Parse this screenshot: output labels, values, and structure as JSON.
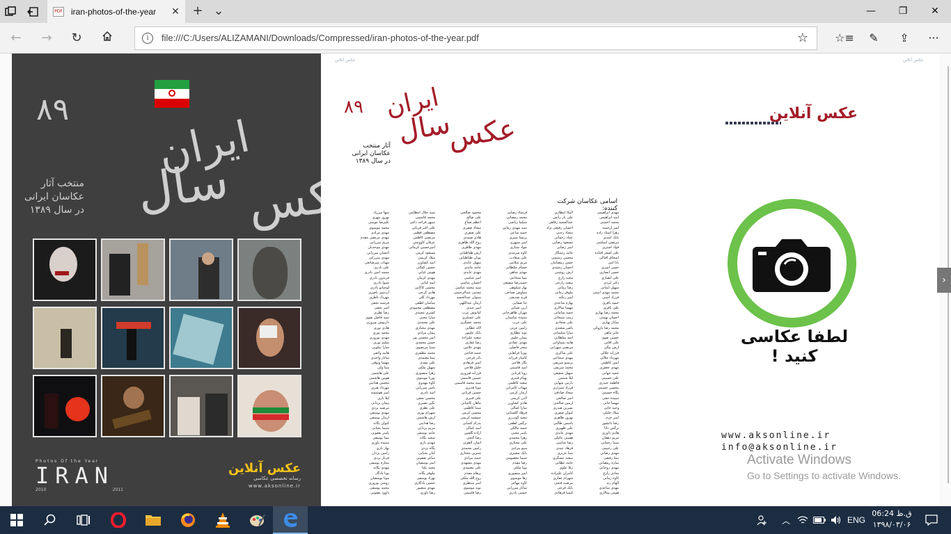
{
  "browser": {
    "tab_title": "iran-photos-of-the-year",
    "tab_favicon": "PDF",
    "url": "file:///C:/Users/ALIZAMANI/Downloads/Compressed/iran-photos-of-the-year.pdf"
  },
  "cover": {
    "title_word_1": "عکس",
    "title_word_2": "سال",
    "title_word_3": "ایران",
    "title_year": "۸۹",
    "subtitle_lines": [
      "منتخب آثار",
      "عکاسان ایرانی",
      "در سال ۱۳۸۹"
    ],
    "footer_label": "Photos Of the Year",
    "footer_word": "IRAN",
    "footer_year_left": "2010",
    "footer_year_right": "2011",
    "brand_name": "عکس آنلاین",
    "brand_tagline": "رسانه تخصصی عکاسی",
    "brand_url": "www.aksonline.ir"
  },
  "inner": {
    "header_left": "عکس آنلاین",
    "header_right": "عکس آنلاین",
    "title_word_1": "عکس",
    "title_word_2": "سال",
    "title_word_3": "ایران",
    "title_year": "۸۹",
    "intro_lines": [
      "آثار منتخب",
      "عکاسان ایرانی",
      "در سال ۱۳۸۹"
    ],
    "list_heading": "اسامی عکاسان شرکت کننده:",
    "photographers": [
      [
        "مهدی ابراهیمی",
        "امید ابراهیمی",
        "محمد احمدی",
        "امیر ارجمند",
        "زهرا استاد زاده",
        "بابک اسدی",
        "مرتضی اسکینی",
        "فواد اشتری",
        "علی اصغر افتاده",
        "اسحاق اقبالی",
        "بابا امن",
        "حسن امیری",
        "حسن انصاری",
        "علی انصاری",
        "دکتر ایزدی",
        "سهیل ایمانی",
        "محمد مهدی امینی",
        "فرزاد امینی",
        "حمید باقری",
        "علی باقری",
        "محمد رضا بهاری",
        "احسان بهمنی",
        "ساناز بهاری",
        "محمد رضا پازوکی",
        "جابر پناهی",
        "حسین تقوی",
        "علی آقایی",
        "آرش بیگی",
        "فرزانه جلالی",
        "مهرداد جلالی",
        "امین کاظمی",
        "مهدی جعفری",
        "حمید جهانی",
        "علی حسینی",
        "فاطمه حیدری",
        "محسن حسینی",
        "پگاه حسینی",
        "سپیده حقی",
        "مهسا خانی",
        "وحید خانی",
        "میلاد خلیلی",
        "امیر خرم",
        "رضا دانشور",
        "نرگس دانا",
        "هادی داوری",
        "مریم دهقان",
        "سینا رحمانی",
        "علی رحیمی",
        "مهدی رضایی",
        "نیما رفیعی",
        "ساره رمضانی",
        "مهدی روحانی",
        "شادی زارع",
        "کاوه زمانی",
        "الهام زند",
        "مهدی ساعدی",
        "هومن سالاری"
      ],
      [
        "الیکا انتظاری",
        "علی بار رانش",
        "عبدالمجید رفاهی",
        "احسان رفیعی نژاد",
        "سجاد رجبی",
        "عماد رحمانی",
        "مسعود رضایی",
        "امیر رضایی",
        "حامد رستگار",
        "محسن رستمی",
        "حسن رمضانیان",
        "احسان رشیدی",
        "آرش روشنی",
        "مجید زارع",
        "سعید زارعی",
        "رضا زمانی",
        "نیلوفر زمانی",
        "امیر زنگنه",
        "بهاره ساعدی",
        "مهسا سالاری",
        "حمید سامانی",
        "زینب سبحانی",
        "علی سجادی",
        "ناصر سعیدی",
        "سارا سلیمانی",
        "امید سلطانی",
        "هانیه سماواتی",
        "مرتضی سهرابی",
        "علی شاکری",
        "مهدی شجاعی",
        "پرستو شریفی",
        "محمد شریفی",
        "سهیل شفیعی",
        "لیلا شمس",
        "نازنین شهابی",
        "فرزاد شیرازی",
        "سجاد صادقی",
        "امیر صالحی",
        "آرمین صالحی",
        "نسرین صدری",
        "کیوان صفری",
        "بهروز طاهری",
        "یاسمن طالبی",
        "علی ظهیری",
        "مهدی عابدی",
        "هستی عاملی",
        "رضا عباسی",
        "فرهاد عبدی",
        "مینا عزیزی",
        "سعید عسگری",
        "حامد عطایی",
        "ژیلا علوی",
        "کامران علیزاده",
        "شهرام غفاری",
        "مرضیه فتحی",
        "بابک فرجی",
        "کیمیا فرهادی"
      ],
      [
        "فرشاد رضایی",
        "محمد رمضانی",
        "شکیبا ریاضی",
        "سید مهدی زمانی",
        "حمید ساعی",
        "پریسا سبزی",
        "امیر سپهری",
        "جواد ستاری",
        "کاوه سرمدی",
        "علی سعادت",
        "مریم سلامی",
        "حسام سلطانی",
        "مهدی شاهی",
        "نیما شجاعی",
        "حمیدرضا شفیعی",
        "بهار شکوهی",
        "سیاوش صباحی",
        "فرید صدیقی",
        "ندا صفایی",
        "آرین ضیایی",
        "مهران طاهرخانی",
        "سپیده عباسیان",
        "علی عرب",
        "رامین عزتی",
        "نوید عطاری",
        "پیمان علوی",
        "مهدی عمادی",
        "سحر فاضلی",
        "پوریا فراهانی",
        "کامیار فرزانه",
        "نگار فلاحی",
        "امید قاسمی",
        "رویا قربانی",
        "بهنام قنبری",
        "سعید کاظمی",
        "مهتاب کامرانی",
        "آرمان کرمی",
        "لادن کریمی",
        "هادی کشاورز",
        "سارا کمالی",
        "فرهاد گلستانی",
        "مجید گودرزی",
        "نرگس لطفی",
        "حمید مالکی",
        "یاسر محبی",
        "زهرا محمدی",
        "علی مختاری",
        "مینو مرادی",
        "بابک مشیری",
        "شیما معصومی",
        "رضا مقدم",
        "پویا ملکی",
        "امیر منصوری",
        "رها موسوی",
        "کاوه مهاجر",
        "ساناز میرزایی",
        "حسین نادری"
      ],
      [
        "محمود صالحی",
        "علی صالح",
        "اعظم صباغ",
        "سجاد صفری",
        "علی صفری",
        "هادی صمدی",
        "روح الله طاهری",
        "مهدی طاهری",
        "آرش طباطبایی",
        "پویان طباطبایی",
        "سهیل عابدی",
        "حامد عابدی",
        "مهدی عابدی",
        "امیر عباسی",
        "احسان عباسی",
        "سید محمد عباسی",
        "مجتبی عبدالرحیمی",
        "سیوان عبدالحمید",
        "آرمان عبداللهی",
        "امیر عبدی",
        "کیانوش عرب",
        "علی عسکری",
        "محمد عسگری",
        "لاله عطایی",
        "بابک علیپور",
        "سعید علیزاده",
        "رضا غفاری",
        "مهدی غلامی",
        "حمید فتاحی",
        "نادر فرجی",
        "امین فرهادی",
        "خلیل فلاحی",
        "فرزانه فیروزی",
        "حسین قاسمی",
        "سید محمد قاسمی",
        "مونا قدیری",
        "حسین قربانی",
        "علی قنبری",
        "ماهان کاشانی",
        "سینا کاظمی",
        "محسن کرمی",
        "جمشید کریمی",
        "پدرام کسایی",
        "امید کمالی",
        "آزاده گلچین",
        "رضا گنجی",
        "ایمان لاهوتی",
        "رامین محمدی",
        "شیرین مختاری",
        "حمید مرادی",
        "مهدی مشهدی",
        "علی معتمدی",
        "پرهام مقدم",
        "روح الله ملکی",
        "امیر منتظری",
        "نوید موسوی",
        "رضا قاسمی"
      ],
      [
        "سید جلال انتظامی",
        "محمد قاسمی",
        "سپهر قراجه داغی",
        "علی اکبر قربانی",
        "مصطفی قطبی",
        "مرتضی کاظمی",
        "عرفان کاووسی",
        "امیرحسین کرمانی",
        "مسعود کرمی",
        "میلاد کریمی",
        "امید کشاورز",
        "حسین کمالی",
        "هومن کیانی",
        "مهدی کرمان",
        "امید کیانی",
        "محسن کاکایی",
        "هادی گرجی",
        "مهرداد گلی",
        "ساسان لطفی",
        "مصطفی محمودی",
        "کسری مجیدی",
        "سارا محبی",
        "علی محمدی",
        "مهدی مختاری",
        "پیمان مرادی",
        "امیر محسن پور",
        "حسن محمدی",
        "سینا مرتضوی",
        "محمد مظفری",
        "نیما معتمدی",
        "علی مقدم",
        "سهیل ملکی",
        "زهرا منصوری",
        "پوریا موسوی",
        "کاوه مهدوی",
        "یاسر میرزایی",
        "امید نادری",
        "محسن نجفی",
        "نگین نصیری",
        "علی نظری",
        "شهرام نوری",
        "آرش هاشمی",
        "رضا هدایتی",
        "مریم یزدانی",
        "حامد یوسفی",
        "سعید یگانه",
        "مهدی یاری",
        "پگاه یزدی",
        "کیان یحیایی",
        "ساغر یعقوبی",
        "امیر یوسفیان",
        "مجید یکتا",
        "نیلوفر یگانه",
        "بهزاد یوسفی",
        "حسین یادگاری",
        "مهدی منصور",
        "رضا یاوری"
      ],
      [
        "سها میرزاد",
        "بهروز مهری",
        "علیرضا مومنی",
        "محمد موسوی",
        "مهدی مرادی",
        "مهدی مرتضی مقدم",
        "مریم میرزایی",
        "مهدی موحدیان",
        "احسان میرزایی",
        "مهدی میرزایی",
        "مهتاب میرصانعی",
        "علی نادری",
        "محمد امین نادری",
        "فریدون نادری",
        "شیوا نادری",
        "لوچیانو نادری",
        "اردشیر ناصری",
        "مهرداد ناظری",
        "فرشید نجفی",
        "امیر نجفی",
        "رضا نظری",
        "سید فاضل نقوی",
        "داریوش نوروزی",
        "هادی نوری",
        "محمد نوری",
        "مهدی نوروزی",
        "سلیم نوری",
        "سارا نیکویی",
        "هانیه واثقی",
        "ساناز واحدی",
        "مهسا وثوقی",
        "مینا ولی",
        "علی هاشمی",
        "هومن هاشمی",
        "محسن هدایتی",
        "مهرداد هنری",
        "امیر هوشمند",
        "لیلا یاری",
        "پیمان یزدانی",
        "مرضیه یزدی",
        "مهدی یوسفی",
        "آرمان یوسفی",
        "کیوان یگانه",
        "شیما یحیایی",
        "یاسر یعقوبی",
        "نیما یوسفی",
        "سپیده یاوری",
        "بهار یاری",
        "رامین یزدان",
        "فرناز یزدی",
        "ستاره یوسفی",
        "مهدی یگانه",
        "پویا یادگار",
        "مونا یوسفیان",
        "روشن نوروزی",
        "محمد یوسفی",
        "داوود یعقوبی"
      ]
    ],
    "brand_name": "عکس آنلاین",
    "badge_text": "لطفا عکاسی کنید !",
    "contact_url": "www.aksonline.ir",
    "contact_email": "info@aksonline.ir"
  },
  "activation": {
    "title": "Activate Windows",
    "subtitle": "Go to Settings to activate Windows."
  },
  "taskbar": {
    "lang": "ENG",
    "time": "06:24 ق.ظ",
    "date": "۱۳۹۸/۰۳/۰۶"
  },
  "colors": {
    "cover_bg": "#403f3f",
    "accent_red": "#a41c28",
    "badge_green": "#6cc24a",
    "taskbar": "#1c2d42"
  }
}
